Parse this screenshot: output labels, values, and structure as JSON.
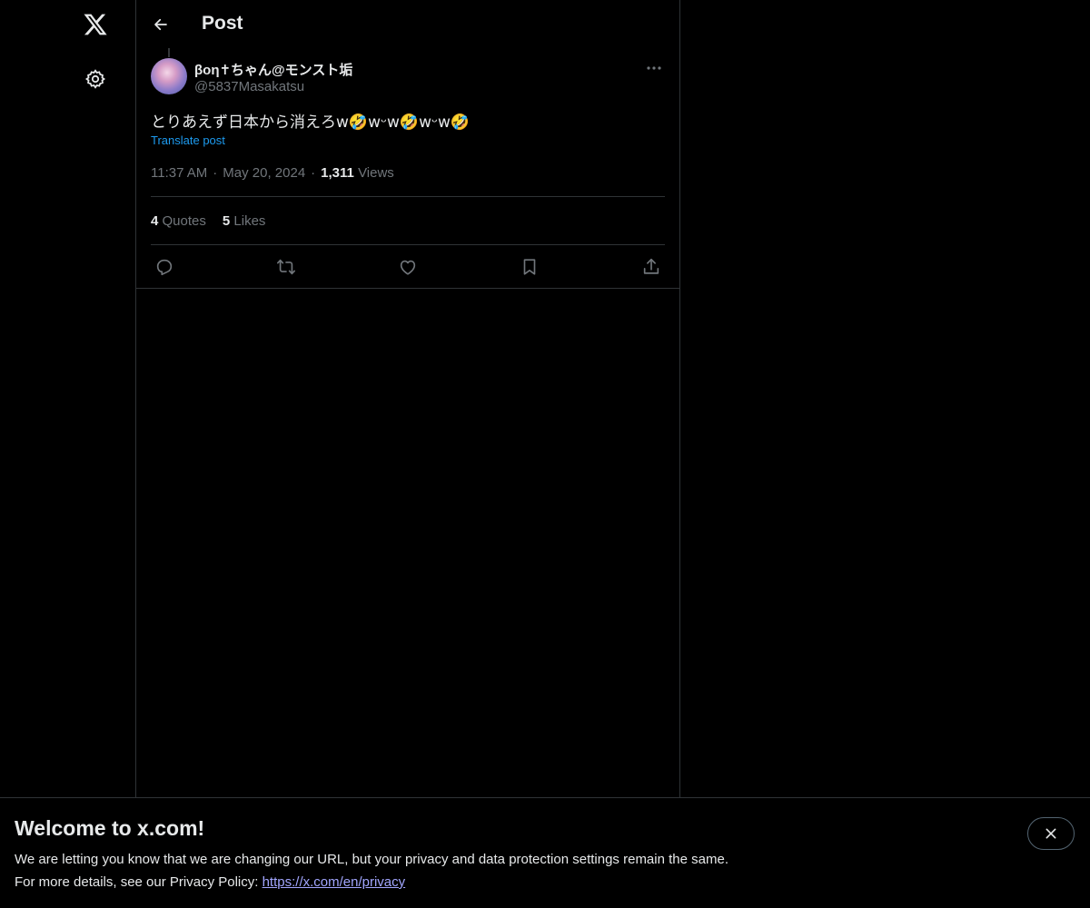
{
  "icons": {
    "logo": "x-logo-icon",
    "settings": "gear-icon",
    "back": "arrow-left-icon",
    "more": "more-horizontal-icon",
    "reply": "reply-icon",
    "repost": "repost-icon",
    "like": "heart-icon",
    "bookmark": "bookmark-icon",
    "share": "share-icon",
    "close": "close-icon"
  },
  "colors": {
    "background": "#000000",
    "text": "#e7e9ea",
    "muted": "#71767b",
    "accent": "#1d9bf0",
    "border": "#2f3336"
  },
  "header": {
    "title": "Post"
  },
  "post": {
    "display_name": "βοη✝ちゃん@モンスト垢",
    "handle": "@5837Masakatsu",
    "text": "とりあえず日本から消えろw🤣wᵕw🤣wᵕw🤣",
    "translate_label": "Translate post",
    "time": "11:37 AM",
    "date": "May 20, 2024",
    "separator": "·",
    "views_count": "1,311",
    "views_label": "Views",
    "quotes_count": "4",
    "quotes_label": "Quotes",
    "likes_count": "5",
    "likes_label": "Likes"
  },
  "banner": {
    "title": "Welcome to x.com!",
    "line1": "We are letting you know that we are changing our URL, but your privacy and data protection settings remain the same.",
    "line2_prefix": "For more details, see our Privacy Policy: ",
    "link_text": "https://x.com/en/privacy"
  }
}
